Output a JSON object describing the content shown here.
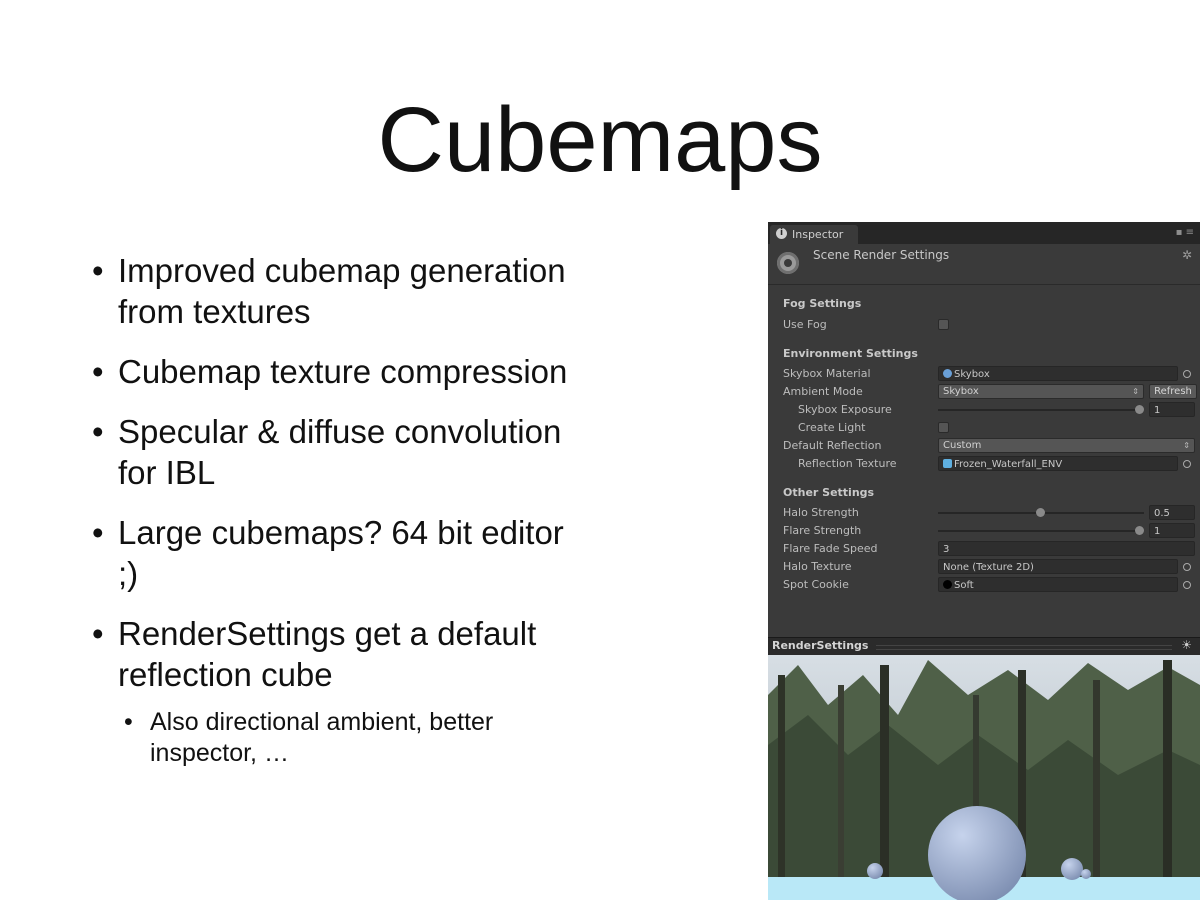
{
  "slide": {
    "title": "Cubemaps",
    "bullets": [
      "Improved cubemap generation from textures",
      "Cubemap texture compression",
      "Specular & diffuse convolution for IBL",
      "Large cubemaps? 64 bit editor ;)",
      "RenderSettings get a default reflection cube"
    ],
    "sub_bullet": "Also directional ambient, better inspector, …",
    "bullet_glyph": "•"
  },
  "inspector": {
    "tab_label": "Inspector",
    "header_title": "Scene Render Settings",
    "fog": {
      "section": "Fog Settings",
      "use_fog_label": "Use Fog"
    },
    "environment": {
      "section": "Environment Settings",
      "skybox_material_label": "Skybox Material",
      "skybox_material_value": "Skybox",
      "ambient_mode_label": "Ambient Mode",
      "ambient_mode_value": "Skybox",
      "refresh_label": "Refresh",
      "skybox_exposure_label": "Skybox Exposure",
      "skybox_exposure_value": "1",
      "create_light_label": "Create Light",
      "default_reflection_label": "Default Reflection",
      "default_reflection_value": "Custom",
      "reflection_texture_label": "Reflection Texture",
      "reflection_texture_value": "Frozen_Waterfall_ENV"
    },
    "other": {
      "section": "Other Settings",
      "halo_strength_label": "Halo Strength",
      "halo_strength_value": "0.5",
      "flare_strength_label": "Flare Strength",
      "flare_strength_value": "1",
      "flare_fade_speed_label": "Flare Fade Speed",
      "flare_fade_speed_value": "3",
      "halo_texture_label": "Halo Texture",
      "halo_texture_value": "None (Texture 2D)",
      "spot_cookie_label": "Spot Cookie",
      "spot_cookie_value": "Soft"
    },
    "render_settings_label": "RenderSettings"
  },
  "colors": {
    "panel_bg": "#3a3a3a",
    "sky": "#c9d3da",
    "ground": "#b9e8f7",
    "sphere": "#a9b8d6"
  }
}
